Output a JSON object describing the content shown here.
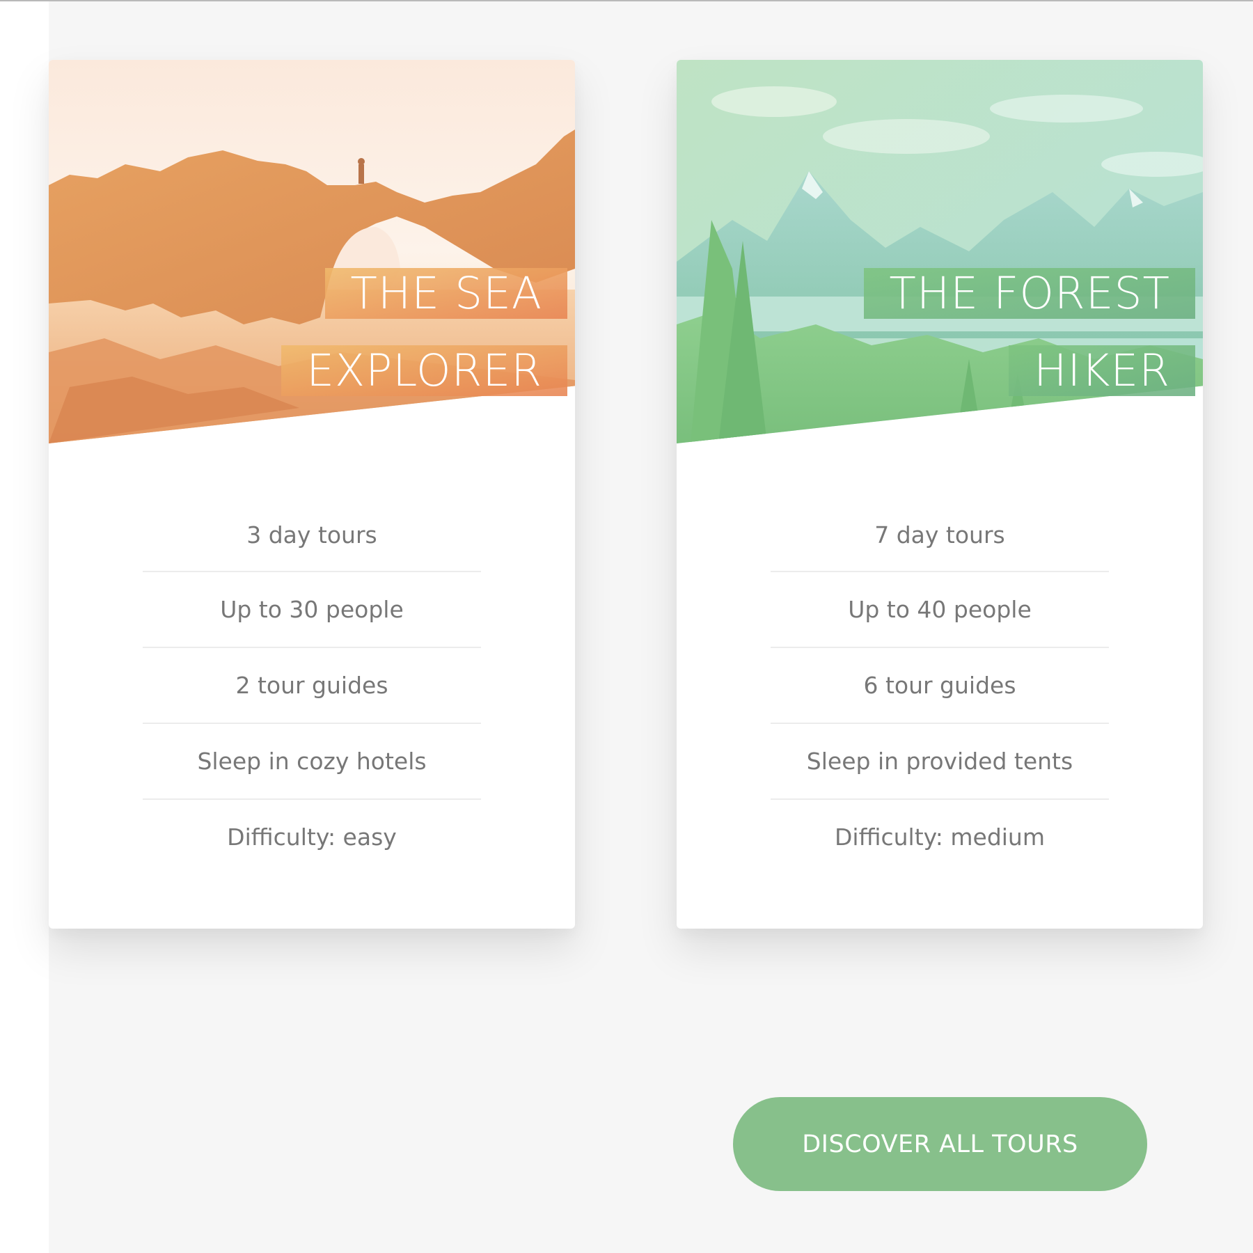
{
  "tours": [
    {
      "id": "sea",
      "heading_line1": "THE SEA",
      "heading_line2": "EXPLORER",
      "accent_color": "#ec9a5e",
      "details": [
        "3 day tours",
        "Up to 30 people",
        "2 tour guides",
        "Sleep in cozy hotels",
        "Difficulty: easy"
      ]
    },
    {
      "id": "forest",
      "heading_line1": "THE FOREST",
      "heading_line2": "HIKER",
      "accent_color": "#7fc286",
      "details": [
        "7 day tours",
        "Up to 40 people",
        "6 tour guides",
        "Sleep in provided tents",
        "Difficulty: medium"
      ]
    }
  ],
  "cta": {
    "label": "DISCOVER ALL TOURS",
    "color": "#87c08b"
  }
}
